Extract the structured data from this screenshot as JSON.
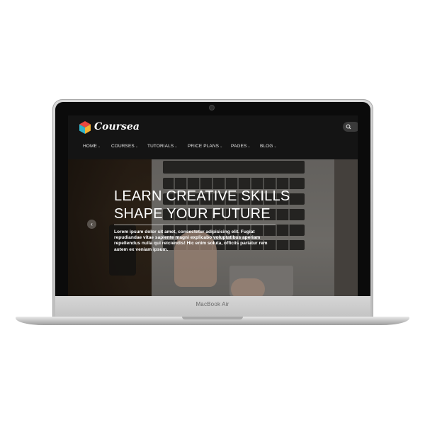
{
  "site": {
    "logo_text": "Coursea",
    "nav": [
      {
        "label": "HOME"
      },
      {
        "label": "COURSES"
      },
      {
        "label": "TUTORIALS"
      },
      {
        "label": "PRICE PLANS"
      },
      {
        "label": "PAGES"
      },
      {
        "label": "BLOG"
      }
    ],
    "search_icon": "search-icon"
  },
  "hero": {
    "title_line1": "LEARN CREATIVE SKILLS",
    "title_line2": "SHAPE YOUR FUTURE",
    "body": "Lorem ipsum dolor sit amet, consectetur adipisicing elit. Fugiat repudiandae vitae sapiente magni explicabo voluptatibus aperiam repellendus nulla qui reiciendis! Hic enim soluta, officiis pariatur rem autem ex veniam ipsum.",
    "prev_arrow": "‹"
  },
  "device": {
    "brand": "MacBook Air"
  },
  "colors": {
    "header_bg": "#141414",
    "text": "#ffffff"
  }
}
